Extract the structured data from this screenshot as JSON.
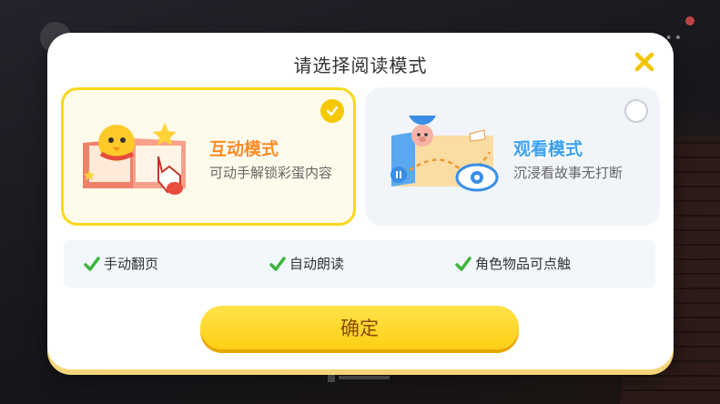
{
  "dialog": {
    "title": "请选择阅读模式",
    "close_icon": "close-icon"
  },
  "modes": [
    {
      "name": "互动模式",
      "description": "可动手解锁彩蛋内容",
      "selected": true
    },
    {
      "name": "观看模式",
      "description": "沉浸看故事无打断",
      "selected": false
    }
  ],
  "features": [
    "手动翻页",
    "自动朗读",
    "角色物品可点触"
  ],
  "confirm_label": "确定",
  "colors": {
    "accent_yellow": "#f9d81c",
    "check_green": "#3cb43c",
    "close_yellow": "#f5c400",
    "interactive_title": "#ff8a1e",
    "watch_title": "#3aa0f0"
  }
}
